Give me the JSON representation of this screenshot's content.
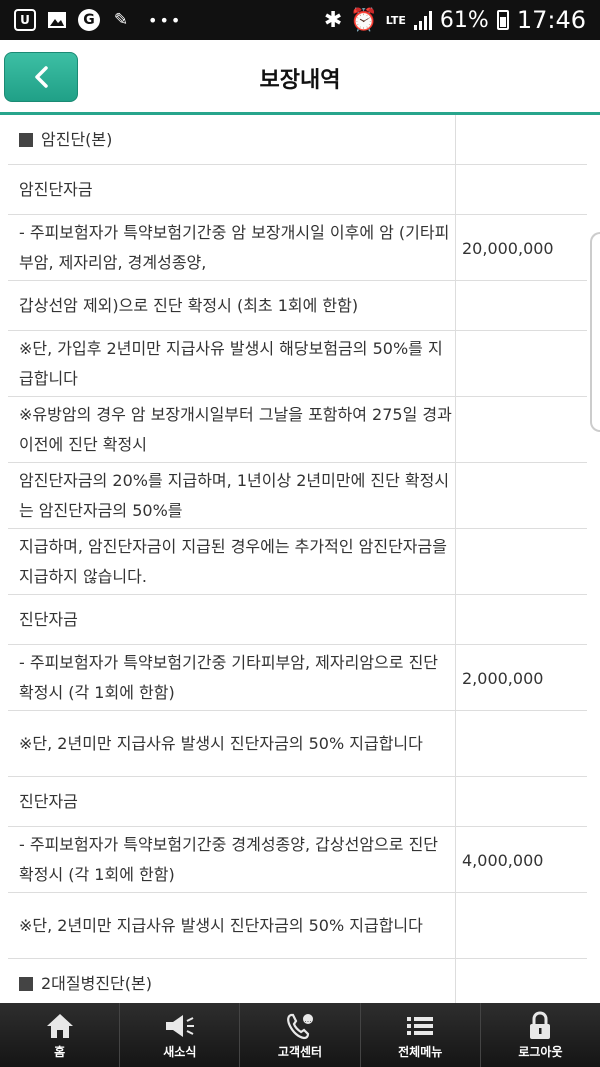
{
  "status_bar": {
    "icon_labels": [
      "U",
      "G"
    ],
    "lte": "LTE",
    "battery": "61%",
    "time": "17:46"
  },
  "header": {
    "title": "보장내역"
  },
  "rows": [
    {
      "text": "암진단(본)",
      "amount": ""
    },
    {
      "text": "암진단자금",
      "amount": ""
    },
    {
      "text": "- 주피보험자가 특약보험기간중 암 보장개시일 이후에 암 (기타피부암, 제자리암, 경계성종양,",
      "amount": "20,000,000"
    },
    {
      "text": "갑상선암 제외)으로 진단 확정시 (최초 1회에 한함)",
      "amount": ""
    },
    {
      "text": "※단, 가입후 2년미만 지급사유 발생시 해당보험금의 50%를 지급합니다",
      "amount": ""
    },
    {
      "text": "※유방암의 경우 암 보장개시일부터 그날을 포함하여 275일 경과 이전에 진단 확정시",
      "amount": ""
    },
    {
      "text": "암진단자금의 20%를 지급하며, 1년이상 2년미만에 진단 확정시는 암진단자금의 50%를",
      "amount": ""
    },
    {
      "text": "지급하며, 암진단자금이 지급된 경우에는 추가적인 암진단자금을 지급하지 않습니다.",
      "amount": ""
    },
    {
      "text": "진단자금",
      "amount": ""
    },
    {
      "text": "- 주피보험자가 특약보험기간중 기타피부암, 제자리암으로  진단 확정시 (각 1회에 한함)",
      "amount": "2,000,000"
    },
    {
      "text": "※단, 2년미만 지급사유 발생시 진단자금의 50% 지급합니다",
      "amount": ""
    },
    {
      "text": "진단자금",
      "amount": ""
    },
    {
      "text": "- 주피보험자가 특약보험기간중 경계성종양, 갑상선암으로  진단 확정시 (각 1회에 한함)",
      "amount": "4,000,000"
    },
    {
      "text": "※단, 2년미만 지급사유 발생시 진단자금의 50% 지급합니다",
      "amount": ""
    },
    {
      "text": "2대질병진단(본)",
      "amount": ""
    }
  ],
  "bottom_nav": [
    {
      "label": "홈",
      "icon": "home-icon"
    },
    {
      "label": "새소식",
      "icon": "megaphone-icon"
    },
    {
      "label": "고객센터",
      "icon": "phone-icon"
    },
    {
      "label": "전체메뉴",
      "icon": "menu-icon"
    },
    {
      "label": "로그아웃",
      "icon": "lock-icon"
    }
  ]
}
